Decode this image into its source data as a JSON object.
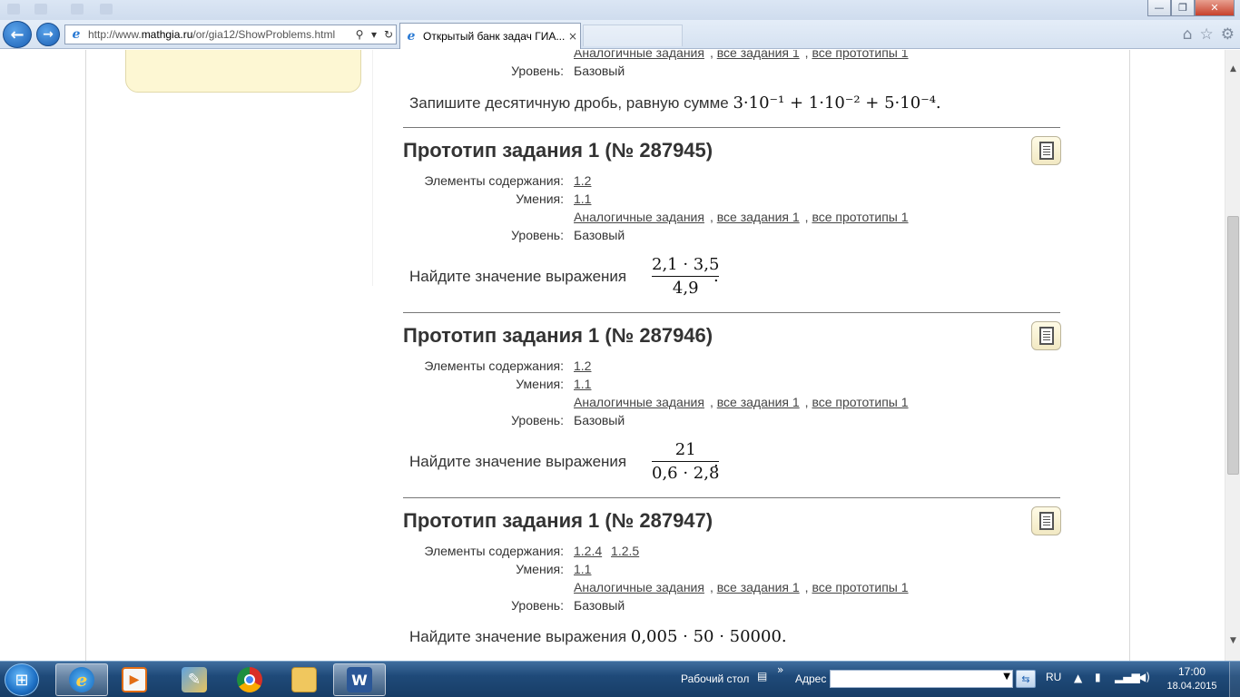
{
  "browser": {
    "url_prefix": "http://www.",
    "url_domain": "mathgia.ru",
    "url_path": "/or/gia12/ShowProblems.html",
    "tab_title": "Открытый банк задач ГИА...",
    "search_icon": "magnifier-icon",
    "dropdown_icon": "chevron-down-icon",
    "refresh_icon": "refresh-icon",
    "tab_close": "×",
    "home_icon": "⌂",
    "favorites_icon": "☆",
    "tools_icon": "⚙",
    "window_buttons": {
      "minimize": "—",
      "maximize": "❐",
      "close": "✕"
    }
  },
  "page": {
    "labels": {
      "elements": "Элементы содержания:",
      "skills": "Умения:",
      "level": "Уровень:"
    },
    "links": {
      "similar": "Аналогичные задания",
      "all_tasks": "все задания 1",
      "all_prototypes": "все прототипы 1"
    },
    "top_block": {
      "level": "Базовый",
      "task_text": "Запишите десятичную дробь, равную сумме",
      "math": "3·10⁻¹ + 1·10⁻² + 5·10⁻⁴."
    },
    "prototypes": [
      {
        "title": "Прототип задания 1 (№ 287945)",
        "elements": [
          "1.2"
        ],
        "skills": "1.1",
        "level": "Базовый",
        "task_text": "Найдите значение выражения",
        "numerator": "2,1 · 3,5",
        "denominator": "4,9",
        "end": "."
      },
      {
        "title": "Прототип задания 1 (№ 287946)",
        "elements": [
          "1.2"
        ],
        "skills": "1.1",
        "level": "Базовый",
        "task_text": "Найдите значение выражения",
        "numerator": "21",
        "denominator": "0,6 · 2,8",
        "end": "."
      },
      {
        "title": "Прототип задания 1 (№ 287947)",
        "elements": [
          "1.2.4",
          "1.2.5"
        ],
        "skills": "1.1",
        "level": "Базовый",
        "task_text": "Найдите значение выражения",
        "math": "0,005 · 50 · 50000."
      }
    ],
    "print_icon": "document-icon"
  },
  "taskbar": {
    "start_icon": "windows-logo-icon",
    "apps": [
      {
        "name": "internet-explorer-icon",
        "glyph": "e",
        "active": true
      },
      {
        "name": "media-player-icon",
        "glyph": "▶",
        "active": false
      },
      {
        "name": "paint-icon",
        "glyph": "✎",
        "active": false
      },
      {
        "name": "chrome-icon",
        "glyph": "",
        "active": false
      },
      {
        "name": "explorer-folder-icon",
        "glyph": "",
        "active": false
      },
      {
        "name": "word-icon",
        "glyph": "W",
        "active": true
      }
    ],
    "desktop_label": "Рабочий стол",
    "chevron": "»",
    "address_label": "Адрес",
    "lang": "RU",
    "time": "17:00",
    "date": "18.04.2015"
  }
}
